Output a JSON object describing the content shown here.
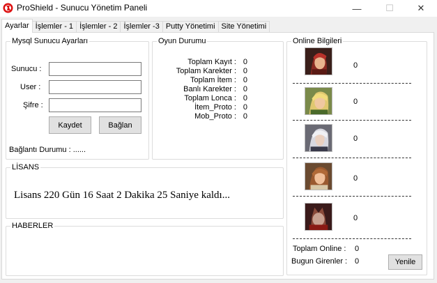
{
  "window": {
    "title": "ProShield - Sunucu Yönetim Paneli",
    "minimize_glyph": "—",
    "maximize_glyph": "☐",
    "close_glyph": "✕"
  },
  "tabs": [
    {
      "label": "Ayarlar",
      "active": true
    },
    {
      "label": "İşlemler - 1"
    },
    {
      "label": "İşlemler - 2"
    },
    {
      "label": "İşlemler -3"
    },
    {
      "label": "Putty Yönetimi"
    },
    {
      "label": "Site Yönetimi"
    }
  ],
  "mysql": {
    "group_title": "Mysql Sunucu Ayarları",
    "server_label": "Sunucu :",
    "user_label": "User :",
    "password_label": "Şifre :",
    "server_value": "",
    "user_value": "",
    "password_value": "",
    "save_label": "Kaydet",
    "connect_label": "Bağlan",
    "status_text": "Bağlantı Durumu : ......"
  },
  "game": {
    "group_title": "Oyun Durumu",
    "stats": [
      {
        "label": "Toplam Kayıt  :",
        "value": "0"
      },
      {
        "label": "Toplam Karekter :",
        "value": "0"
      },
      {
        "label": "Toplam İtem  :",
        "value": "0"
      },
      {
        "label": "Banlı Karekter :",
        "value": "0"
      },
      {
        "label": "Toplam Lonca :",
        "value": "0"
      },
      {
        "label": "İtem_Proto :",
        "value": "0"
      },
      {
        "label": "Mob_Proto :",
        "value": "0"
      }
    ]
  },
  "license": {
    "group_title": "LİSANS",
    "text": "Lisans 220 Gün 16 Saat 2 Dakika 25 Saniye kaldı..."
  },
  "news": {
    "group_title": "HABERLER"
  },
  "online": {
    "group_title": "Online Bilgileri",
    "classes": [
      {
        "icon": "warrior-portrait-icon",
        "value": "0"
      },
      {
        "icon": "rogue-portrait-icon",
        "value": "0"
      },
      {
        "icon": "mage-portrait-icon",
        "value": "0"
      },
      {
        "icon": "priest-portrait-icon",
        "value": "0"
      },
      {
        "icon": "kurian-portrait-icon",
        "value": "0"
      }
    ],
    "total_label": "Toplam Online :",
    "total_value": "0",
    "today_label": "Bugun Girenler :",
    "today_value": "0",
    "refresh_label": "Yenile"
  }
}
